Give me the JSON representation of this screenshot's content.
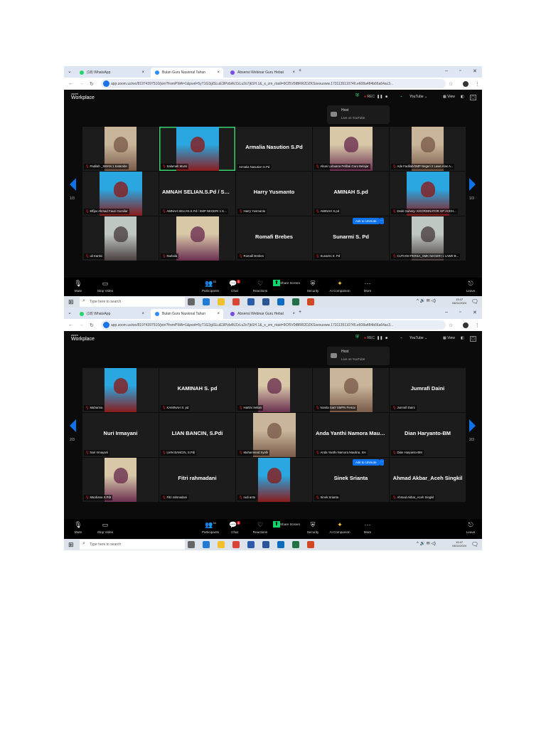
{
  "screenshots": [
    {
      "tabs": [
        "(18) WhatsApp",
        "Bulan Guru Nasional Tahun",
        "Absensi Webinar Guru Hebat"
      ],
      "url": "app.zoom.us/wc/81974397510/join?fromPWA=1&pwd=5yT1G3glSLuE3lPzbAVZzLu2o7jkSH.1&_x_zm_rtaid=9Cf5V0tBRR2DZKSsexuoww.1731135110746.e608a484b66a64ac3...",
      "brand_small": "zoom",
      "brand": "Workplace",
      "rec": "REC",
      "youtube": "YouTube",
      "view": "View",
      "host_title": "Host",
      "host_sub": "Live on YouTube",
      "page_indicator": "1/3",
      "ask_to_unmute": "Ask to Unmute",
      "participants_count": "33",
      "chat_badge": "1",
      "tiles": [
        {
          "label": "Padilah _SMAN 1 Ketambe",
          "photo": true
        },
        {
          "label": "Salamah Murni",
          "photo": true,
          "speaking": true
        },
        {
          "name": "Armalia Nasution S.Pd",
          "label": "Armalia Nasution S.Pd"
        },
        {
          "label": "Akuni Lubuana Pelibai Guru Belajar",
          "photo": true
        },
        {
          "label": "Ade Fadilah/SMP Negeri 2 Lawe Alas A...",
          "photo": true
        },
        {
          "label": "Elfijar Ahmad Fauzi Gumilar",
          "photo": true
        },
        {
          "name": "AMNAH SELIAN.S.Pd / SMP ...",
          "label": "AMNAH SELIAN.S.Pd / SMP NEGERI 1 K..."
        },
        {
          "name": "Harry Yusmanto",
          "label": "Harry Yusmanto"
        },
        {
          "name": "AMINAH S.pd",
          "label": "AMINAH S.pd"
        },
        {
          "label": "Dede Suhery- KOORDINATOR GP ACEH...",
          "photo": true
        },
        {
          "label": "uli Kartini",
          "photo": true
        },
        {
          "label": "Nurlaila",
          "photo": true
        },
        {
          "name": "Romafi Brebes",
          "label": "Romafi Brebes"
        },
        {
          "name": "Sunarmi S. Pd",
          "label": "Sunarmi S. Pd"
        },
        {
          "label": "CUTIANI PERSA_SMK NEGERI 1 LAWE B...",
          "photo": true
        }
      ]
    },
    {
      "tabs": [
        "(18) WhatsApp",
        "Bulan Guru Nasional Tahun",
        "Absensi Webinar Guru Hebat"
      ],
      "url": "app.zoom.us/wc/81974397510/join?fromPWA=1&pwd=5yT1G3glSLuE3lPzbAVZzLu2o7jkSH.1&_x_zm_rtaid=9Cf5V0tBRR2DZKSsexuoww.1731135110746.e608a484b66a64ac3...",
      "brand_small": "zoom",
      "brand": "Workplace",
      "rec": "REC",
      "youtube": "YouTube",
      "view": "View",
      "host_title": "Host",
      "host_sub": "Live on YouTube",
      "page_indicator": "2/3",
      "ask_to_unmute": "Ask to Unmute",
      "participants_count": "34",
      "chat_badge": "1",
      "tiles": [
        {
          "label": "Maharina",
          "photo": true
        },
        {
          "name": "KAMINAH S. pd",
          "label": "KAMINAH S. pd"
        },
        {
          "label": "Hartini Selian",
          "photo": true
        },
        {
          "label": "Novita Sari/ SMPN Pemai",
          "photo": true
        },
        {
          "name": "Jumrafi Daini",
          "label": "Jumrafi Daini"
        },
        {
          "name": "Nuri Irmayani",
          "label": "Nuri Irmayani"
        },
        {
          "name": "LIAN BANCIN, S.Pdi",
          "label": "LIAN BANCIN, S.Pdi"
        },
        {
          "label": "Muhammad Syafii",
          "photo": true
        },
        {
          "name": "Anda Yanthi Namora Maulin...",
          "label": "Anda Yanthi Namora Maulina, SH"
        },
        {
          "name": "Dian Haryanto-BM",
          "label": "Dian Haryanto-BM"
        },
        {
          "label": "Mardiana S.PdI",
          "photo": true
        },
        {
          "name": "Fitri rahmadani",
          "label": "Fitri rahmadani"
        },
        {
          "label": "rudi anto",
          "photo": true
        },
        {
          "name": "Sinek Srianta",
          "label": "Sinek Srianta"
        },
        {
          "name": "Ahmad Akbar_Aceh Singkil",
          "label": "Ahmad Akbar_Aceh Singkil"
        }
      ]
    }
  ],
  "toolbar": {
    "mute": "Mute",
    "stop_video": "Stop Video",
    "participants": "Participants",
    "chat": "Chat",
    "reactions": "Reactions",
    "share_screen": "Share Screen",
    "security": "Security",
    "ai_companion": "AI Companion",
    "more": "More",
    "leave": "Leave"
  },
  "taskbar": {
    "search_placeholder": "Type here to search",
    "time": "15:47",
    "date": "06/11/2024"
  },
  "colors": {
    "accent": "#0e72ed",
    "speaking": "#3bd16f",
    "muted": "#e02424",
    "share": "#0fd66b"
  }
}
